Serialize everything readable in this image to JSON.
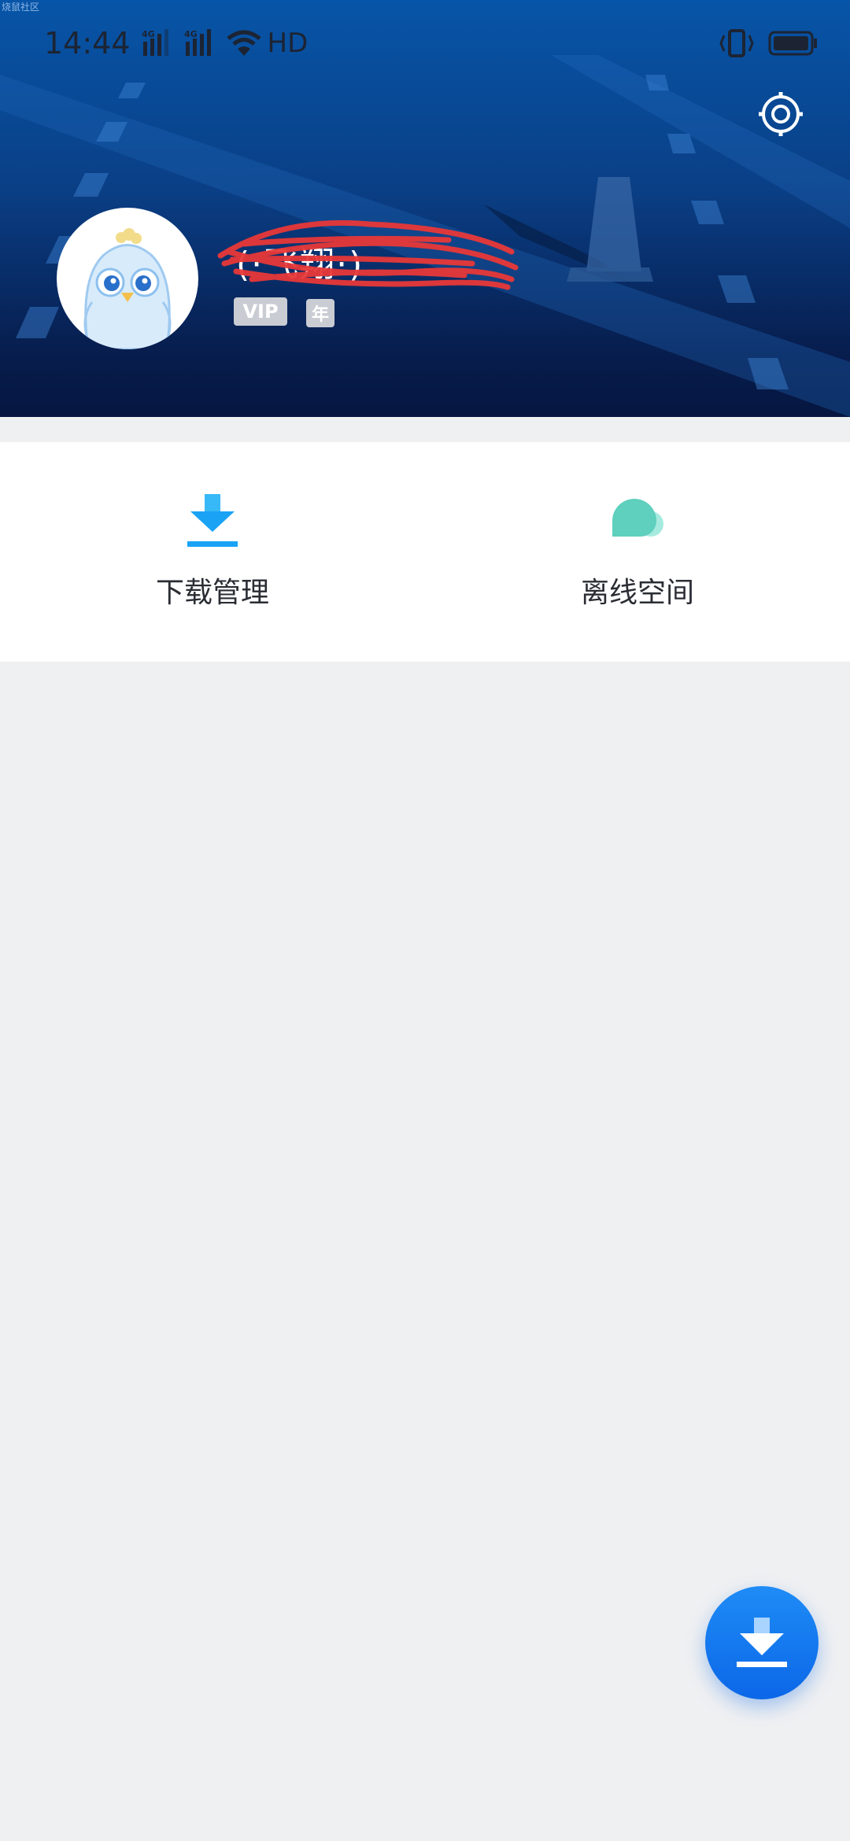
{
  "watermark": "烧鼠社区",
  "status_bar": {
    "time": "14:44",
    "network_1": "4G",
    "network_2": "4G",
    "hd_label": "HD"
  },
  "profile": {
    "username": "(·飞翔·)",
    "badges": [
      "VIP",
      "年"
    ]
  },
  "features": [
    {
      "label": "下载管理",
      "icon": "download-icon",
      "color": "#1aa3f5"
    },
    {
      "label": "离线空间",
      "icon": "cloud-icon",
      "color": "#5ed0bd"
    }
  ],
  "colors": {
    "header_top": "#0755a8",
    "header_bottom": "#061640",
    "page_bg": "#eff0f2",
    "fab": "#0c67e8"
  }
}
